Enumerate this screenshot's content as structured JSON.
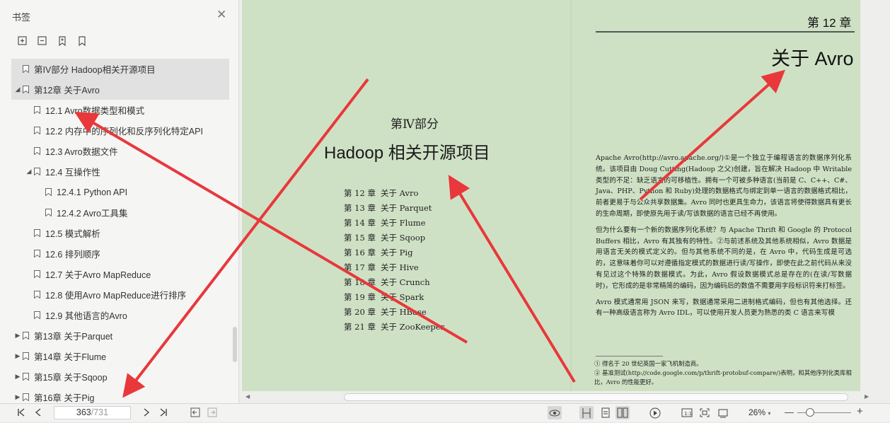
{
  "panel": {
    "title": "书签",
    "close_glyph": "✕"
  },
  "bookmarks": [
    {
      "label": "第IV部分 Hadoop相关开源项目",
      "twisty": "",
      "selected": true
    },
    {
      "label": "第12章 关于Avro",
      "twisty": "◢",
      "selected": true
    },
    {
      "label": "12.1 Avro数据类型和模式",
      "twisty": "",
      "selected": false
    },
    {
      "label": "12.2 内存中的序列化和反序列化特定API",
      "twisty": "",
      "selected": false
    },
    {
      "label": "12.3 Avro数据文件",
      "twisty": "",
      "selected": false
    },
    {
      "label": "12.4 互操作性",
      "twisty": "◢",
      "selected": false
    },
    {
      "label": "12.4.1 Python API",
      "twisty": "",
      "selected": false
    },
    {
      "label": "12.4.2 Avro工具集",
      "twisty": "",
      "selected": false
    },
    {
      "label": "12.5 模式解析",
      "twisty": "",
      "selected": false
    },
    {
      "label": "12.6 排列顺序",
      "twisty": "",
      "selected": false
    },
    {
      "label": "12.7 关于Avro MapReduce",
      "twisty": "",
      "selected": false
    },
    {
      "label": "12.8 使用Avro MapReduce进行排序",
      "twisty": "",
      "selected": false
    },
    {
      "label": "12.9 其他语言的Avro",
      "twisty": "",
      "selected": false
    },
    {
      "label": "第13章 关于Parquet",
      "twisty": "▶",
      "selected": false
    },
    {
      "label": "第14章 关于Flume",
      "twisty": "▶",
      "selected": false
    },
    {
      "label": "第15章 关于Sqoop",
      "twisty": "▶",
      "selected": false
    },
    {
      "label": "第16章 关于Pig",
      "twisty": "▶",
      "selected": false
    }
  ],
  "left_page": {
    "part": "第Ⅳ部分",
    "subtitle": "Hadoop 相关开源项目",
    "toc": [
      {
        "num": "第 12 章",
        "name": "关于 Avro"
      },
      {
        "num": "第 13 章",
        "name": "关于 Parquet"
      },
      {
        "num": "第 14 章",
        "name": "关于 Flume"
      },
      {
        "num": "第 15 章",
        "name": "关于 Sqoop"
      },
      {
        "num": "第 16 章",
        "name": "关于 Pig"
      },
      {
        "num": "第 17 章",
        "name": "关于 Hive"
      },
      {
        "num": "第 18 章",
        "name": "关于 Crunch"
      },
      {
        "num": "第 19 章",
        "name": "关于 Spark"
      },
      {
        "num": "第 20 章",
        "name": "关于 HBase"
      },
      {
        "num": "第 21 章",
        "name": "关于 ZooKeeper"
      }
    ]
  },
  "right_page": {
    "chapter_no": "第 12 章",
    "chapter_title": "关于 Avro",
    "paragraphs": [
      "Apache Avro(http://avro.apache.org/)①是一个独立于编程语言的数据序列化系统。该项目由 Doug Cutting(Hadoop 之父)创建，旨在解决 Hadoop 中 Writable 类型的不足：缺乏语言的可移植性。拥有一个可被多种语言(当前是 C、C++、C#、Java、PHP、Python 和 Ruby)处理的数据格式与绑定到单一语言的数据格式相比，前者更易于与公众共享数据集。Avro 同时也更具生命力，该语言将使得数据具有更长的生命周期，即使原先用于读/写该数据的语言已经不再使用。",
      "但为什么要有一个新的数据序列化系统？与 Apache Thrift 和 Google 的 Protocol Buffers 相比，Avro 有其独有的特性。②与前述系统及其他系统相似，Avro 数据是用语言无关的模式定义的。但与其他系统不同的是，在 Avro 中，代码生成是可选的，这意味着你可以对遵循指定模式的数据进行读/写操作，即使在此之前代码从来没有见过这个特殊的数据模式。为此，Avro 假设数据模式总是存在的(在读/写数据时)，它形成的是非常精简的编码，因为编码后的数值不需要用字段标识符来打标签。",
      "Avro 模式通常用 JSON 来写，数据通常采用二进制格式编码，但也有其他选择。还有一种高级语言称为 Avro IDL，可以使用开发人员更为熟悉的类 C 语言来写模"
    ],
    "footnotes": [
      "① 得名于 20 世纪英国一家飞机制造商。",
      "② 基准测试(http://code.google.com/p/thrift-protobuf-compare/)表明，和其他序列化类库相比，Avro 的性能更好。"
    ]
  },
  "statusbar": {
    "page_current": "363",
    "page_total": "/731",
    "zoom": "26%",
    "zoom_minus": "—",
    "zoom_plus": "+",
    "zoom_caret": "▾"
  },
  "colors": {
    "page_bg": "#cfe1c5",
    "arrow": "#e8383b"
  }
}
